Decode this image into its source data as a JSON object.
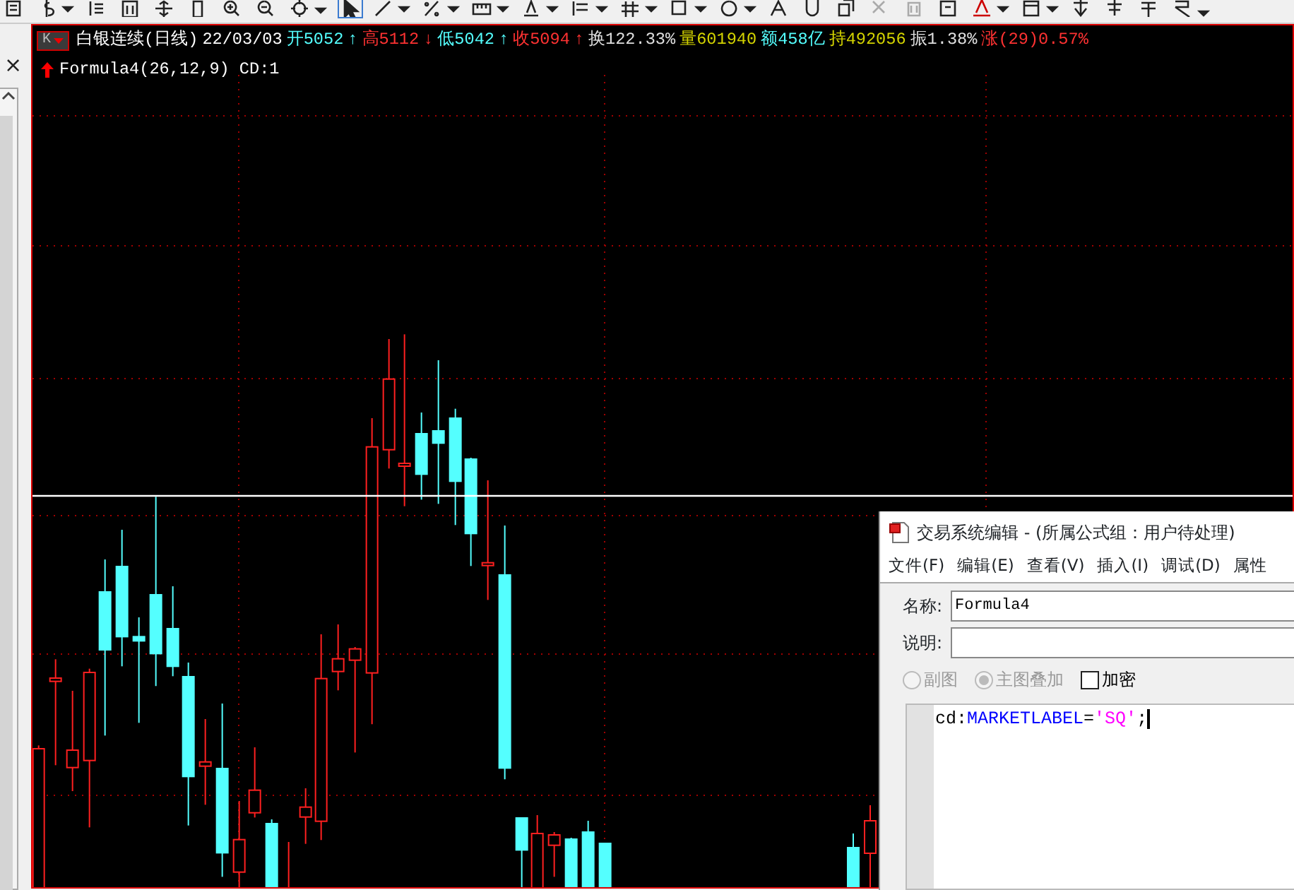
{
  "left_panel": {
    "close": "×"
  },
  "chart": {
    "period_button": {
      "label": "K"
    },
    "quote": [
      {
        "text": "白银连续(日线)",
        "color": "#ffffff"
      },
      {
        "text": "22/03/03",
        "color": "#ffffff"
      },
      {
        "text": "开5052",
        "color": "#54ffff"
      },
      {
        "text": "↑",
        "color": "#54ffff"
      },
      {
        "text": "高5112",
        "color": "#ff3232"
      },
      {
        "text": "↓",
        "color": "#ff3232"
      },
      {
        "text": "低5042",
        "color": "#54ffff"
      },
      {
        "text": "↑",
        "color": "#54ffff"
      },
      {
        "text": "收5094",
        "color": "#ff3232"
      },
      {
        "text": "↑",
        "color": "#ff3232"
      },
      {
        "text": "换122.33%",
        "color": "#e0e0e0"
      },
      {
        "text": "量601940",
        "color": "#d4d400"
      },
      {
        "text": "额458亿",
        "color": "#54ffff"
      },
      {
        "text": "持492056",
        "color": "#d4d400"
      },
      {
        "text": "振1.38%",
        "color": "#e0e0e0"
      },
      {
        "text": "涨(29)0.57%",
        "color": "#ff3232"
      }
    ],
    "indicator": "Formula4(26,12,9) CD:1"
  },
  "dialog": {
    "title": "交易系统编辑 - (所属公式组：用户待处理)",
    "menu": [
      "文件(F)",
      "编辑(E)",
      "查看(V)",
      "插入(I)",
      "调试(D)",
      "属性"
    ],
    "fields": [
      {
        "label": "名称:",
        "value": "Formula4"
      },
      {
        "label": "说明:"
      }
    ],
    "options": [
      {
        "kind": "radio",
        "label": "副图",
        "selected": false,
        "disabled": true
      },
      {
        "kind": "radio",
        "label": "主图叠加",
        "selected": true,
        "disabled": true
      },
      {
        "kind": "checkbox",
        "label": "加密",
        "checked": false,
        "disabled": false
      }
    ],
    "code": [
      {
        "text": "cd:",
        "color": "#000000"
      },
      {
        "text": "MARKETLABEL",
        "color": "#0000ff"
      },
      {
        "text": "=",
        "color": "#000000"
      },
      {
        "text": "'SQ'",
        "color": "#ff00ff"
      },
      {
        "text": ";",
        "color": "#000000"
      }
    ]
  }
}
